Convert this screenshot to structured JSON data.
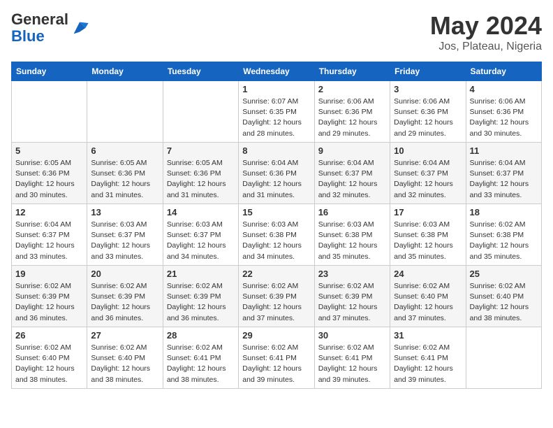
{
  "header": {
    "logo_general": "General",
    "logo_blue": "Blue",
    "month_title": "May 2024",
    "location": "Jos, Plateau, Nigeria"
  },
  "weekdays": [
    "Sunday",
    "Monday",
    "Tuesday",
    "Wednesday",
    "Thursday",
    "Friday",
    "Saturday"
  ],
  "weeks": [
    [
      {
        "day": "",
        "info": ""
      },
      {
        "day": "",
        "info": ""
      },
      {
        "day": "",
        "info": ""
      },
      {
        "day": "1",
        "info": "Sunrise: 6:07 AM\nSunset: 6:35 PM\nDaylight: 12 hours\nand 28 minutes."
      },
      {
        "day": "2",
        "info": "Sunrise: 6:06 AM\nSunset: 6:36 PM\nDaylight: 12 hours\nand 29 minutes."
      },
      {
        "day": "3",
        "info": "Sunrise: 6:06 AM\nSunset: 6:36 PM\nDaylight: 12 hours\nand 29 minutes."
      },
      {
        "day": "4",
        "info": "Sunrise: 6:06 AM\nSunset: 6:36 PM\nDaylight: 12 hours\nand 30 minutes."
      }
    ],
    [
      {
        "day": "5",
        "info": "Sunrise: 6:05 AM\nSunset: 6:36 PM\nDaylight: 12 hours\nand 30 minutes."
      },
      {
        "day": "6",
        "info": "Sunrise: 6:05 AM\nSunset: 6:36 PM\nDaylight: 12 hours\nand 31 minutes."
      },
      {
        "day": "7",
        "info": "Sunrise: 6:05 AM\nSunset: 6:36 PM\nDaylight: 12 hours\nand 31 minutes."
      },
      {
        "day": "8",
        "info": "Sunrise: 6:04 AM\nSunset: 6:36 PM\nDaylight: 12 hours\nand 31 minutes."
      },
      {
        "day": "9",
        "info": "Sunrise: 6:04 AM\nSunset: 6:37 PM\nDaylight: 12 hours\nand 32 minutes."
      },
      {
        "day": "10",
        "info": "Sunrise: 6:04 AM\nSunset: 6:37 PM\nDaylight: 12 hours\nand 32 minutes."
      },
      {
        "day": "11",
        "info": "Sunrise: 6:04 AM\nSunset: 6:37 PM\nDaylight: 12 hours\nand 33 minutes."
      }
    ],
    [
      {
        "day": "12",
        "info": "Sunrise: 6:04 AM\nSunset: 6:37 PM\nDaylight: 12 hours\nand 33 minutes."
      },
      {
        "day": "13",
        "info": "Sunrise: 6:03 AM\nSunset: 6:37 PM\nDaylight: 12 hours\nand 33 minutes."
      },
      {
        "day": "14",
        "info": "Sunrise: 6:03 AM\nSunset: 6:37 PM\nDaylight: 12 hours\nand 34 minutes."
      },
      {
        "day": "15",
        "info": "Sunrise: 6:03 AM\nSunset: 6:38 PM\nDaylight: 12 hours\nand 34 minutes."
      },
      {
        "day": "16",
        "info": "Sunrise: 6:03 AM\nSunset: 6:38 PM\nDaylight: 12 hours\nand 35 minutes."
      },
      {
        "day": "17",
        "info": "Sunrise: 6:03 AM\nSunset: 6:38 PM\nDaylight: 12 hours\nand 35 minutes."
      },
      {
        "day": "18",
        "info": "Sunrise: 6:02 AM\nSunset: 6:38 PM\nDaylight: 12 hours\nand 35 minutes."
      }
    ],
    [
      {
        "day": "19",
        "info": "Sunrise: 6:02 AM\nSunset: 6:39 PM\nDaylight: 12 hours\nand 36 minutes."
      },
      {
        "day": "20",
        "info": "Sunrise: 6:02 AM\nSunset: 6:39 PM\nDaylight: 12 hours\nand 36 minutes."
      },
      {
        "day": "21",
        "info": "Sunrise: 6:02 AM\nSunset: 6:39 PM\nDaylight: 12 hours\nand 36 minutes."
      },
      {
        "day": "22",
        "info": "Sunrise: 6:02 AM\nSunset: 6:39 PM\nDaylight: 12 hours\nand 37 minutes."
      },
      {
        "day": "23",
        "info": "Sunrise: 6:02 AM\nSunset: 6:39 PM\nDaylight: 12 hours\nand 37 minutes."
      },
      {
        "day": "24",
        "info": "Sunrise: 6:02 AM\nSunset: 6:40 PM\nDaylight: 12 hours\nand 37 minutes."
      },
      {
        "day": "25",
        "info": "Sunrise: 6:02 AM\nSunset: 6:40 PM\nDaylight: 12 hours\nand 38 minutes."
      }
    ],
    [
      {
        "day": "26",
        "info": "Sunrise: 6:02 AM\nSunset: 6:40 PM\nDaylight: 12 hours\nand 38 minutes."
      },
      {
        "day": "27",
        "info": "Sunrise: 6:02 AM\nSunset: 6:40 PM\nDaylight: 12 hours\nand 38 minutes."
      },
      {
        "day": "28",
        "info": "Sunrise: 6:02 AM\nSunset: 6:41 PM\nDaylight: 12 hours\nand 38 minutes."
      },
      {
        "day": "29",
        "info": "Sunrise: 6:02 AM\nSunset: 6:41 PM\nDaylight: 12 hours\nand 39 minutes."
      },
      {
        "day": "30",
        "info": "Sunrise: 6:02 AM\nSunset: 6:41 PM\nDaylight: 12 hours\nand 39 minutes."
      },
      {
        "day": "31",
        "info": "Sunrise: 6:02 AM\nSunset: 6:41 PM\nDaylight: 12 hours\nand 39 minutes."
      },
      {
        "day": "",
        "info": ""
      }
    ]
  ]
}
